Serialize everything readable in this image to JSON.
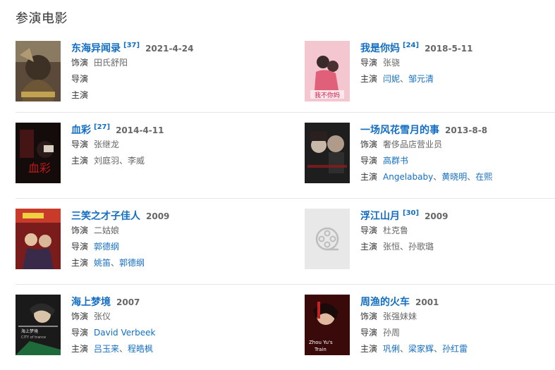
{
  "section_title": "参演电影",
  "labels": {
    "role": "饰演",
    "director": "导演",
    "starring": "主演"
  },
  "sep": "、",
  "movies": [
    {
      "title": "东海异闻录",
      "cite": "[37]",
      "year": "2021-4-24",
      "role": "田氏舒阳",
      "director": [],
      "starring": []
    },
    {
      "title": "我是你妈",
      "cite": "[24]",
      "year": "2018-5-11",
      "director_text": "张骁",
      "starring": [
        "闫妮",
        "邹元清"
      ]
    },
    {
      "title": "血彩",
      "cite": "[27]",
      "year": "2014-4-11",
      "director_text": "张继龙",
      "starring_text": "刘庭羽、李威"
    },
    {
      "title": "一场风花雪月的事",
      "year": "2013-8-8",
      "role": "奢侈品店营业员",
      "director": [
        "高群书"
      ],
      "starring": [
        "Angelababy",
        "黄晓明",
        "在熙"
      ]
    },
    {
      "title": "三笑之才子佳人",
      "year": "2009",
      "role": "二姑娘",
      "director": [
        "郭德纲"
      ],
      "starring": [
        "姚笛",
        "郭德纲"
      ]
    },
    {
      "title": "浮江山月",
      "cite": "[30]",
      "year": "2009",
      "director_text": "杜克鲁",
      "starring_text": "张恒、孙歌璐"
    },
    {
      "title": "海上梦境",
      "year": "2007",
      "role": "张仪",
      "director": [
        "David Verbeek"
      ],
      "starring": [
        "吕玉来",
        "程皓枫"
      ]
    },
    {
      "title": "周渔的火车",
      "year": "2001",
      "role": "张强妹妹",
      "director_text": "孙周",
      "starring": [
        "巩俐",
        "梁家辉",
        "孙红雷"
      ]
    }
  ],
  "posters": {
    "p2_text": "我不你妈",
    "p3_text": "血彩",
    "p7_title": "海上梦境",
    "p7_sub": "CITY of trance",
    "p8_title": "Zhou Yu's",
    "p8_sub": "Train"
  }
}
